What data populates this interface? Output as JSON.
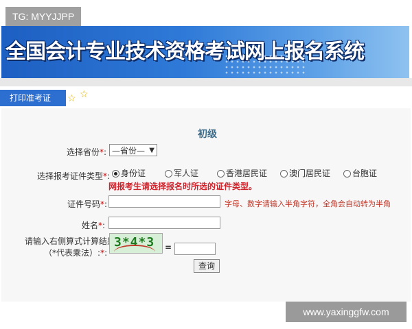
{
  "watermark_top_left": "TG: MYYJJPP",
  "watermark_bottom_right": "www.yaxinggfw.com",
  "banner": {
    "title": "全国会计专业技术资格考试网上报名系统"
  },
  "tab": {
    "label": "打印准考证",
    "star_glyph": "☆"
  },
  "form": {
    "level": "初级",
    "required_mark": "*",
    "province": {
      "label": "选择省份",
      "colon": ":",
      "selected": "—省份—"
    },
    "id_type": {
      "label": "选择报考证件类型",
      "colon": ":",
      "options": [
        "身份证",
        "军人证",
        "香港居民证",
        "澳门居民证",
        "台胞证"
      ],
      "selected_index": 0,
      "warning": "网报考生请选择报名时所选的证件类型。"
    },
    "id_number": {
      "label": "证件号码",
      "colon": ":",
      "value": "",
      "hint": "字母、数字请输入半角字符，全角会自动转为半角"
    },
    "name": {
      "label": "姓名",
      "colon": ":",
      "value": ""
    },
    "captcha": {
      "label_line1": "请输入右侧算式计算结果",
      "label_line2": "（*代表乘法）",
      "colon": ":",
      "image_text": "3*4*3",
      "equals": "=",
      "value": ""
    },
    "query_button": "查询"
  },
  "colors": {
    "banner_blue": "#2f7ad8",
    "tab_blue": "#2d6fd0",
    "warning_red": "#d0242c",
    "captcha_green": "#1f7a1f"
  }
}
